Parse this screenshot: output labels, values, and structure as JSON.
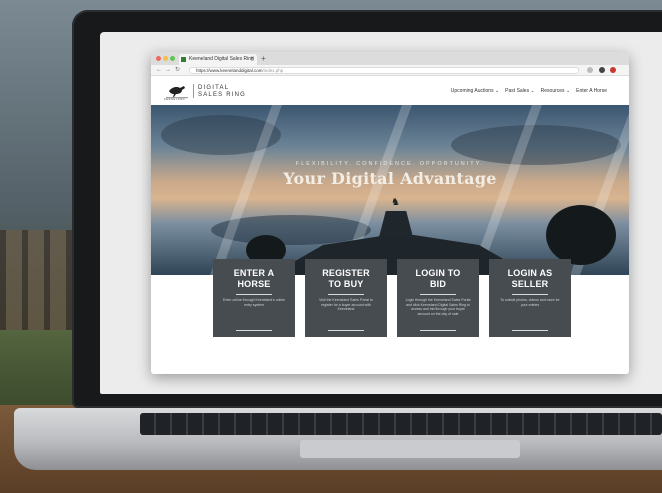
{
  "browser": {
    "tab_title": "Keeneland Digital Sales Ring",
    "tab_close": "×",
    "new_tab": "+",
    "url_host": "https://www.keenelanddigital.com",
    "url_path": "/index.php",
    "back_icon": "←",
    "forward_icon": "→",
    "reload_icon": "↻"
  },
  "site": {
    "logo_word": "KEENELAND",
    "brand_line1": "DIGITAL",
    "brand_line2": "SALES RING",
    "nav": [
      {
        "label": "Upcoming Auctions ⌄"
      },
      {
        "label": "Past Sales ⌄"
      },
      {
        "label": "Resources ⌄"
      },
      {
        "label": "Enter A Horse"
      }
    ]
  },
  "hero": {
    "tagline": "FLEXIBILITY. CONFIDENCE. OPPORTUNITY.",
    "title": "Your Digital Advantage"
  },
  "cards": [
    {
      "title_l1": "ENTER A",
      "title_l2": "HORSE",
      "desc": "Enter online through Keeneland's online entry system"
    },
    {
      "title_l1": "REGISTER",
      "title_l2": "TO BUY",
      "desc": "Visit the Keeneland Sales Portal to register for a buyer account with Keeneland"
    },
    {
      "title_l1": "LOGIN TO",
      "title_l2": "BID",
      "desc": "Login through the Keeneland Sales Portal and click Keeneland Digital Sales Ring to access and bid through your buyer account on the day of sale"
    },
    {
      "title_l1": "LOGIN AS",
      "title_l2": "SELLER",
      "desc": "To submit photos, videos and more for your entries"
    }
  ],
  "colors": {
    "card_bg": "#474c51",
    "laptop_bezel": "#17191b"
  }
}
